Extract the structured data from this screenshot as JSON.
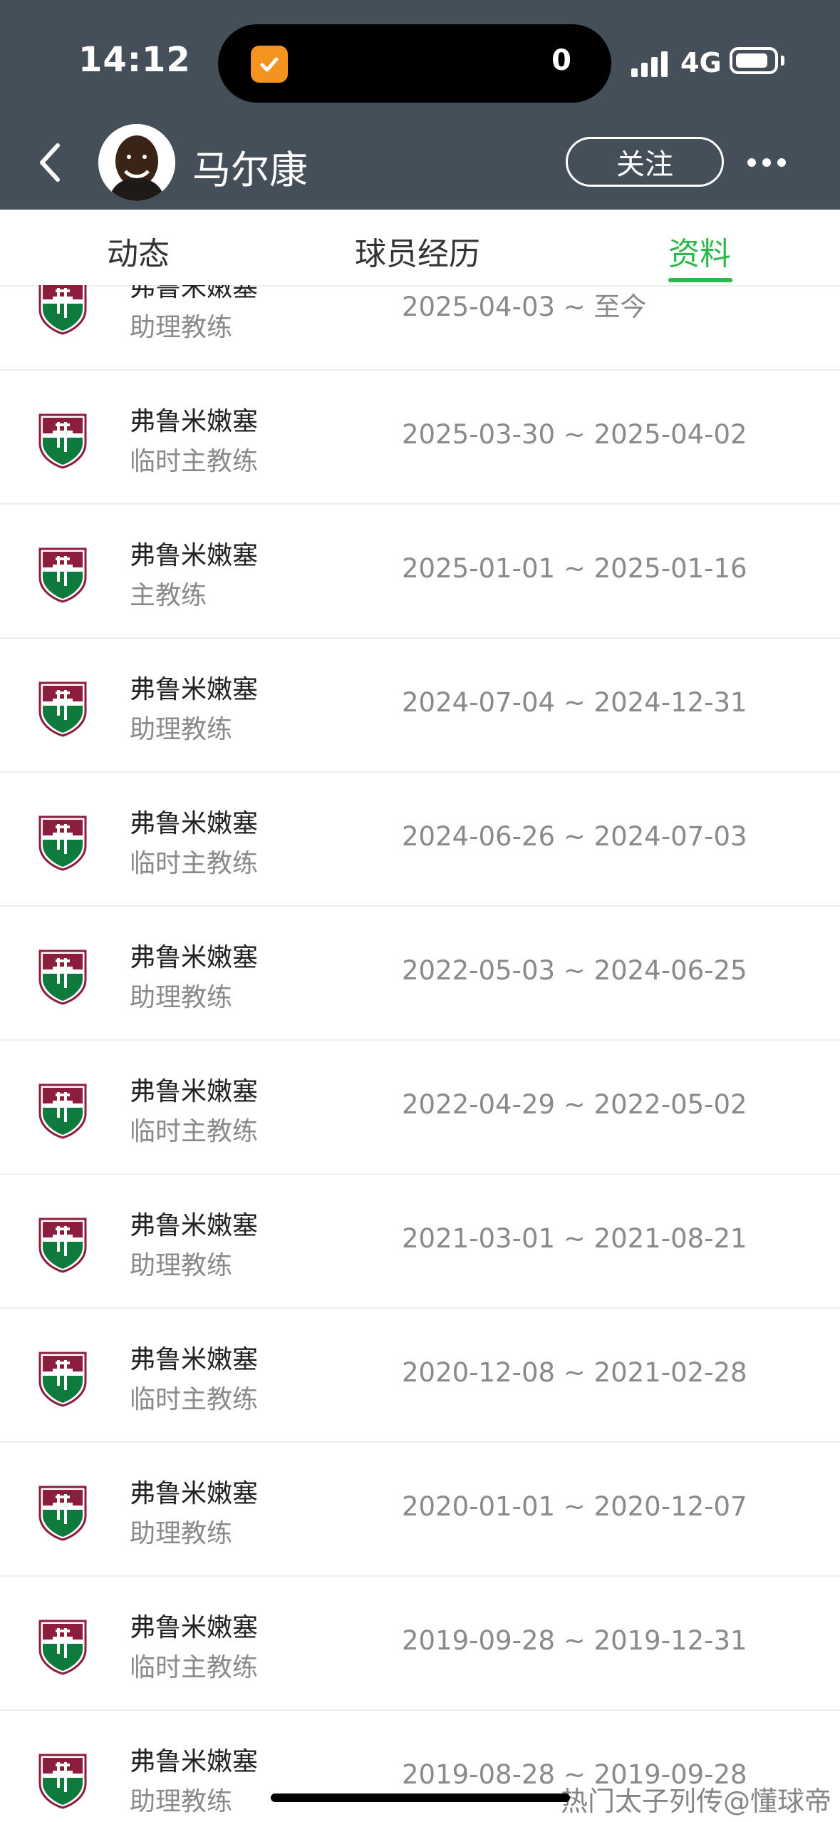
{
  "status_bar": {
    "time": "14:12",
    "island_count": "0",
    "network": "4G"
  },
  "header": {
    "coach_name": "马尔康",
    "follow_label": "关注"
  },
  "tabs": [
    {
      "label": "动态",
      "active": false
    },
    {
      "label": "球员经历",
      "active": false
    },
    {
      "label": "资料",
      "active": true
    }
  ],
  "career": [
    {
      "team": "弗鲁米嫩塞",
      "role": "助理教练",
      "dates": "2025-04-03 ~ 至今"
    },
    {
      "team": "弗鲁米嫩塞",
      "role": "临时主教练",
      "dates": "2025-03-30 ~ 2025-04-02"
    },
    {
      "team": "弗鲁米嫩塞",
      "role": "主教练",
      "dates": "2025-01-01 ~ 2025-01-16"
    },
    {
      "team": "弗鲁米嫩塞",
      "role": "助理教练",
      "dates": "2024-07-04 ~ 2024-12-31"
    },
    {
      "team": "弗鲁米嫩塞",
      "role": "临时主教练",
      "dates": "2024-06-26 ~ 2024-07-03"
    },
    {
      "team": "弗鲁米嫩塞",
      "role": "助理教练",
      "dates": "2022-05-03 ~ 2024-06-25"
    },
    {
      "team": "弗鲁米嫩塞",
      "role": "临时主教练",
      "dates": "2022-04-29 ~ 2022-05-02"
    },
    {
      "team": "弗鲁米嫩塞",
      "role": "助理教练",
      "dates": "2021-03-01 ~ 2021-08-21"
    },
    {
      "team": "弗鲁米嫩塞",
      "role": "临时主教练",
      "dates": "2020-12-08 ~ 2021-02-28"
    },
    {
      "team": "弗鲁米嫩塞",
      "role": "助理教练",
      "dates": "2020-01-01 ~ 2020-12-07"
    },
    {
      "team": "弗鲁米嫩塞",
      "role": "临时主教练",
      "dates": "2019-09-28 ~ 2019-12-31"
    },
    {
      "team": "弗鲁米嫩塞",
      "role": "助理教练",
      "dates": "2019-08-28 ~ 2019-09-28"
    }
  ],
  "watermark": "热门太子列传@懂球帝",
  "colors": {
    "header_bg": "#454f5a",
    "accent_green": "#2db84d",
    "crest_maroon": "#8c1d3c",
    "crest_green": "#0e7a3e"
  }
}
